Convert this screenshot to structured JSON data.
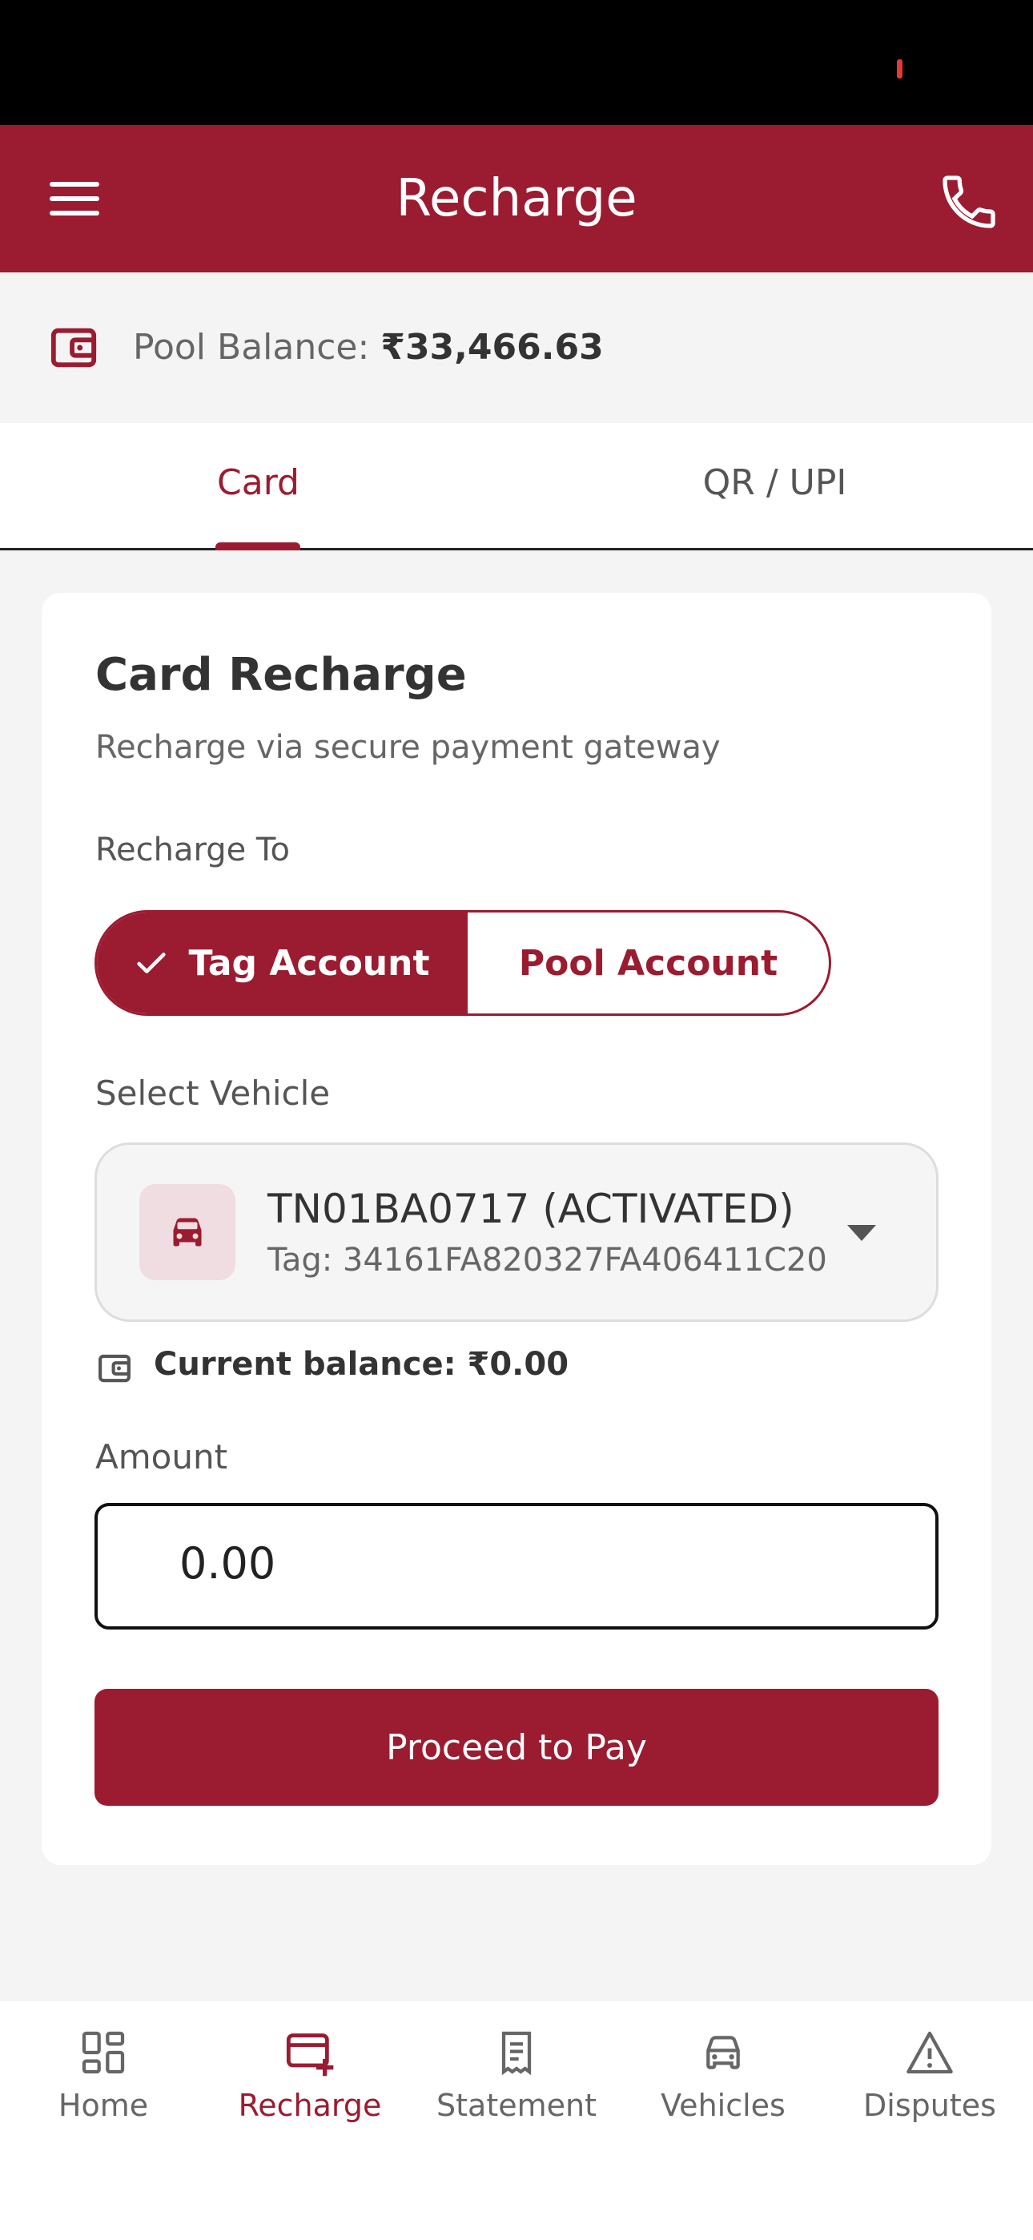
{
  "app_bar": {
    "title": "Recharge"
  },
  "pool_balance": {
    "label": "Pool Balance:",
    "value": "₹33,466.63"
  },
  "tabs": [
    {
      "label": "Card"
    },
    {
      "label": "QR / UPI"
    }
  ],
  "card": {
    "title": "Card Recharge",
    "subtitle": "Recharge via secure payment gateway",
    "recharge_to_label": "Recharge To",
    "segments": {
      "tag": "Tag Account",
      "pool": "Pool Account"
    },
    "select_vehicle_label": "Select Vehicle",
    "vehicle": {
      "name": "TN01BA0717 (ACTIVATED)",
      "tag": "Tag: 34161FA820327FA406411C20"
    },
    "current_balance": "Current balance: ₹0.00",
    "amount_label": "Amount",
    "amount_value": "0.00",
    "pay_button": "Proceed to Pay"
  },
  "bottom_nav": [
    {
      "label": "Home",
      "icon": "dashboard-icon"
    },
    {
      "label": "Recharge",
      "icon": "card-add-icon"
    },
    {
      "label": "Statement",
      "icon": "receipt-icon"
    },
    {
      "label": "Vehicles",
      "icon": "car-icon"
    },
    {
      "label": "Disputes",
      "icon": "warning-icon"
    }
  ],
  "colors": {
    "primary": "#9b1b30",
    "background": "#f4f4f4"
  }
}
